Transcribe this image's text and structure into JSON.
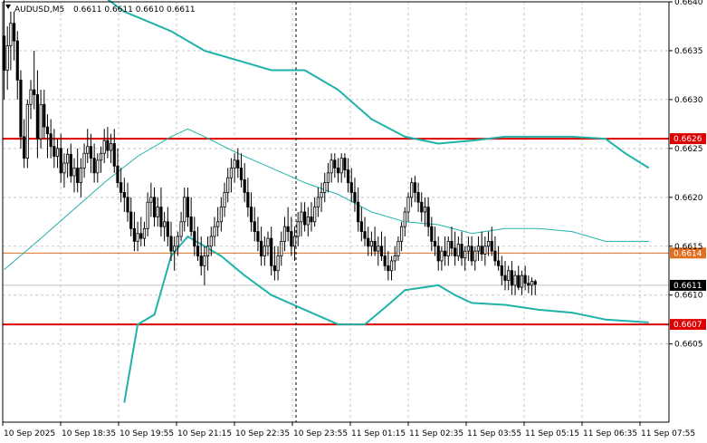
{
  "header": {
    "symbol_text": "AUDUSD,M5",
    "ohlc_text": "0.6611 0.6611 0.6610 0.6611"
  },
  "colors": {
    "bollinger": "#20b2aa",
    "sma": "#20b2aa",
    "level_major": "#dd0000",
    "level_minor": "#e07020",
    "price_line": "#c0c0c0",
    "candle": "#000000",
    "grid": "#c8c8c8"
  },
  "chart_data": {
    "type": "candlestick",
    "symbol": "AUDUSD",
    "timeframe": "M5",
    "ylim": [
      0.6597,
      0.664
    ],
    "y_ticks": [
      "0.6640",
      "0.6635",
      "0.6630",
      "0.6625",
      "0.6620",
      "0.6615",
      "0.6610",
      "0.6605"
    ],
    "x_ticks": [
      "10 Sep 2025",
      "10 Sep 18:35",
      "10 Sep 19:55",
      "10 Sep 21:15",
      "10 Sep 22:35",
      "10 Sep 23:55",
      "11 Sep 01:15",
      "11 Sep 02:35",
      "11 Sep 03:55",
      "11 Sep 05:15",
      "11 Sep 06:35",
      "11 Sep 07:55"
    ],
    "current_price": "0.6611",
    "levels": [
      {
        "value": 0.6626,
        "label": "0.6626",
        "kind": "major"
      },
      {
        "value": 0.66143,
        "label": "0.6614",
        "kind": "minor"
      },
      {
        "value": 0.6607,
        "label": "0.6607",
        "kind": "major"
      }
    ],
    "bollinger_upper": [
      [
        0,
        0.6641
      ],
      [
        28,
        0.6641
      ],
      [
        36,
        0.6639
      ],
      [
        50,
        0.6637
      ],
      [
        60,
        0.6635
      ],
      [
        70,
        0.6634
      ],
      [
        80,
        0.6633
      ],
      [
        90,
        0.6633
      ],
      [
        100,
        0.6631
      ],
      [
        110,
        0.6628
      ],
      [
        120,
        0.66262
      ],
      [
        130,
        0.66255
      ],
      [
        140,
        0.66258
      ],
      [
        150,
        0.66262
      ],
      [
        160,
        0.66262
      ],
      [
        170,
        0.66262
      ],
      [
        180,
        0.6626
      ],
      [
        186,
        0.66245
      ],
      [
        193,
        0.6623
      ]
    ],
    "bollinger_middle": [
      [
        0,
        0.66126
      ],
      [
        10,
        0.66155
      ],
      [
        20,
        0.66185
      ],
      [
        30,
        0.66215
      ],
      [
        40,
        0.66242
      ],
      [
        50,
        0.66262
      ],
      [
        55,
        0.6627
      ],
      [
        60,
        0.66262
      ],
      [
        70,
        0.66245
      ],
      [
        80,
        0.6623
      ],
      [
        90,
        0.66215
      ],
      [
        100,
        0.66203
      ],
      [
        110,
        0.66185
      ],
      [
        120,
        0.66175
      ],
      [
        130,
        0.66172
      ],
      [
        140,
        0.66163
      ],
      [
        150,
        0.66168
      ],
      [
        160,
        0.66168
      ],
      [
        170,
        0.66165
      ],
      [
        180,
        0.66155
      ],
      [
        193,
        0.66155
      ]
    ],
    "bollinger_lower": [
      [
        36,
        0.6599
      ],
      [
        40,
        0.6607
      ],
      [
        45,
        0.6608
      ],
      [
        50,
        0.6614
      ],
      [
        55,
        0.6616
      ],
      [
        65,
        0.6614
      ],
      [
        72,
        0.6612
      ],
      [
        80,
        0.661
      ],
      [
        90,
        0.66085
      ],
      [
        100,
        0.6607
      ],
      [
        108,
        0.6607
      ],
      [
        115,
        0.6609
      ],
      [
        120,
        0.66105
      ],
      [
        130,
        0.6611
      ],
      [
        135,
        0.661
      ],
      [
        140,
        0.66092
      ],
      [
        150,
        0.6609
      ],
      [
        160,
        0.66085
      ],
      [
        170,
        0.66082
      ],
      [
        180,
        0.66075
      ],
      [
        193,
        0.66072
      ]
    ],
    "candles": [
      [
        0.66365,
        0.6641,
        0.663,
        0.6633
      ],
      [
        0.6633,
        0.66375,
        0.6631,
        0.66355
      ],
      [
        0.66355,
        0.6639,
        0.6633,
        0.66378
      ],
      [
        0.66378,
        0.6639,
        0.6634,
        0.6636
      ],
      [
        0.6636,
        0.6637,
        0.663,
        0.6632
      ],
      [
        0.6632,
        0.6633,
        0.6625,
        0.66262
      ],
      [
        0.66262,
        0.6628,
        0.6623,
        0.6624
      ],
      [
        0.6624,
        0.663,
        0.6623,
        0.66295
      ],
      [
        0.66295,
        0.6632,
        0.6628,
        0.6631
      ],
      [
        0.6631,
        0.6635,
        0.6629,
        0.66305
      ],
      [
        0.66305,
        0.6633,
        0.6624,
        0.6626
      ],
      [
        0.6626,
        0.6631,
        0.6625,
        0.66295
      ],
      [
        0.66295,
        0.6631,
        0.6626,
        0.66272
      ],
      [
        0.66272,
        0.66285,
        0.6624,
        0.66265
      ],
      [
        0.66265,
        0.6628,
        0.6624,
        0.66252
      ],
      [
        0.66252,
        0.6627,
        0.6623,
        0.66242
      ],
      [
        0.66242,
        0.6626,
        0.6623,
        0.6625
      ],
      [
        0.6625,
        0.66265,
        0.66215,
        0.66225
      ],
      [
        0.66225,
        0.66245,
        0.6621,
        0.66235
      ],
      [
        0.66235,
        0.6625,
        0.6622,
        0.66244
      ],
      [
        0.66244,
        0.66255,
        0.66215,
        0.66222
      ],
      [
        0.66222,
        0.6624,
        0.66205,
        0.6623
      ],
      [
        0.6623,
        0.6625,
        0.66205,
        0.66215
      ],
      [
        0.66215,
        0.6624,
        0.662,
        0.6623
      ],
      [
        0.6623,
        0.66255,
        0.6622,
        0.66245
      ],
      [
        0.66245,
        0.6627,
        0.66235,
        0.66252
      ],
      [
        0.66252,
        0.66265,
        0.66225,
        0.6624
      ],
      [
        0.6624,
        0.66255,
        0.66215,
        0.66225
      ],
      [
        0.66225,
        0.66245,
        0.66215,
        0.66238
      ],
      [
        0.66238,
        0.66252,
        0.66225,
        0.66245
      ],
      [
        0.66245,
        0.6627,
        0.66235,
        0.66258
      ],
      [
        0.66258,
        0.66272,
        0.6624,
        0.66248
      ],
      [
        0.66248,
        0.66265,
        0.66235,
        0.66255
      ],
      [
        0.66255,
        0.6627,
        0.66225,
        0.66232
      ],
      [
        0.66232,
        0.6625,
        0.6621,
        0.66215
      ],
      [
        0.66215,
        0.6623,
        0.66195,
        0.66205
      ],
      [
        0.66205,
        0.6622,
        0.66185,
        0.662
      ],
      [
        0.662,
        0.66215,
        0.66175,
        0.66185
      ],
      [
        0.66185,
        0.662,
        0.6616,
        0.66168
      ],
      [
        0.66168,
        0.66185,
        0.66145,
        0.66155
      ],
      [
        0.66155,
        0.66175,
        0.66145,
        0.66163
      ],
      [
        0.66163,
        0.6618,
        0.6615,
        0.66158
      ],
      [
        0.66158,
        0.66175,
        0.6615,
        0.66168
      ],
      [
        0.66168,
        0.66205,
        0.6616,
        0.66195
      ],
      [
        0.66195,
        0.66215,
        0.6618,
        0.662
      ],
      [
        0.662,
        0.6621,
        0.6617,
        0.6618
      ],
      [
        0.6618,
        0.662,
        0.6617,
        0.6619
      ],
      [
        0.6619,
        0.6621,
        0.6616,
        0.6617
      ],
      [
        0.6617,
        0.66185,
        0.66155,
        0.66175
      ],
      [
        0.66175,
        0.6619,
        0.6615,
        0.6616
      ],
      [
        0.6616,
        0.66175,
        0.66135,
        0.66145
      ],
      [
        0.66145,
        0.6616,
        0.66125,
        0.6615
      ],
      [
        0.6615,
        0.66165,
        0.6614,
        0.6616
      ],
      [
        0.6616,
        0.66185,
        0.66155,
        0.66175
      ],
      [
        0.66175,
        0.6621,
        0.66165,
        0.662
      ],
      [
        0.662,
        0.6621,
        0.6617,
        0.6618
      ],
      [
        0.6618,
        0.662,
        0.6616,
        0.66165
      ],
      [
        0.66165,
        0.6618,
        0.6614,
        0.6615
      ],
      [
        0.6615,
        0.6617,
        0.66135,
        0.6614
      ],
      [
        0.6614,
        0.6616,
        0.6612,
        0.6613
      ],
      [
        0.6613,
        0.6615,
        0.6611,
        0.6614
      ],
      [
        0.6614,
        0.6616,
        0.66125,
        0.6615
      ],
      [
        0.6615,
        0.6617,
        0.6614,
        0.6616
      ],
      [
        0.6616,
        0.6618,
        0.6615,
        0.6617
      ],
      [
        0.6617,
        0.6619,
        0.6616,
        0.66175
      ],
      [
        0.66175,
        0.662,
        0.66165,
        0.6619
      ],
      [
        0.6619,
        0.66215,
        0.6618,
        0.66205
      ],
      [
        0.66205,
        0.6623,
        0.66195,
        0.6622
      ],
      [
        0.6622,
        0.6624,
        0.66205,
        0.6623
      ],
      [
        0.6623,
        0.66245,
        0.66215,
        0.66238
      ],
      [
        0.66238,
        0.6625,
        0.6622,
        0.6623
      ],
      [
        0.6623,
        0.66245,
        0.6621,
        0.66218
      ],
      [
        0.66218,
        0.66235,
        0.66195,
        0.66205
      ],
      [
        0.66205,
        0.6622,
        0.6618,
        0.6619
      ],
      [
        0.6619,
        0.66205,
        0.66165,
        0.66175
      ],
      [
        0.66175,
        0.6619,
        0.66155,
        0.66165
      ],
      [
        0.66165,
        0.6618,
        0.66145,
        0.66155
      ],
      [
        0.66155,
        0.6617,
        0.6613,
        0.6614
      ],
      [
        0.6614,
        0.6616,
        0.6613,
        0.6615
      ],
      [
        0.6615,
        0.66165,
        0.6614,
        0.66158
      ],
      [
        0.66158,
        0.6617,
        0.6612,
        0.6613
      ],
      [
        0.6613,
        0.6615,
        0.66115,
        0.66125
      ],
      [
        0.66125,
        0.6615,
        0.66115,
        0.6614
      ],
      [
        0.6614,
        0.66165,
        0.6613,
        0.66155
      ],
      [
        0.66155,
        0.6618,
        0.66145,
        0.6617
      ],
      [
        0.6617,
        0.6619,
        0.66155,
        0.66165
      ],
      [
        0.66165,
        0.6618,
        0.6614,
        0.6615
      ],
      [
        0.6615,
        0.6617,
        0.66135,
        0.6616
      ],
      [
        0.6616,
        0.66185,
        0.6615,
        0.66175
      ],
      [
        0.66175,
        0.66195,
        0.6616,
        0.66185
      ],
      [
        0.66185,
        0.66195,
        0.66165,
        0.66172
      ],
      [
        0.66172,
        0.6619,
        0.6616,
        0.6618
      ],
      [
        0.6618,
        0.66195,
        0.66165,
        0.66175
      ],
      [
        0.66175,
        0.662,
        0.6617,
        0.6619
      ],
      [
        0.6619,
        0.6621,
        0.6618,
        0.662
      ],
      [
        0.662,
        0.66215,
        0.66185,
        0.66205
      ],
      [
        0.66205,
        0.66225,
        0.66195,
        0.66215
      ],
      [
        0.66215,
        0.66235,
        0.66205,
        0.66225
      ],
      [
        0.66225,
        0.66245,
        0.66215,
        0.66238
      ],
      [
        0.66238,
        0.66245,
        0.6622,
        0.6623
      ],
      [
        0.6623,
        0.6624,
        0.66215,
        0.66225
      ],
      [
        0.66225,
        0.66245,
        0.66215,
        0.6624
      ],
      [
        0.6624,
        0.66245,
        0.6622,
        0.66228
      ],
      [
        0.66228,
        0.6624,
        0.66205,
        0.66215
      ],
      [
        0.66215,
        0.6623,
        0.66195,
        0.66205
      ],
      [
        0.66205,
        0.6622,
        0.66185,
        0.66195
      ],
      [
        0.66195,
        0.6621,
        0.66165,
        0.66175
      ],
      [
        0.66175,
        0.6619,
        0.66155,
        0.66165
      ],
      [
        0.66165,
        0.6618,
        0.6615,
        0.66158
      ],
      [
        0.66158,
        0.6617,
        0.6614,
        0.6615
      ],
      [
        0.6615,
        0.66165,
        0.6614,
        0.66155
      ],
      [
        0.66155,
        0.6617,
        0.6614,
        0.66145
      ],
      [
        0.66145,
        0.6616,
        0.6613,
        0.6615
      ],
      [
        0.6615,
        0.66165,
        0.66135,
        0.6614
      ],
      [
        0.6614,
        0.6616,
        0.66125,
        0.6613
      ],
      [
        0.6613,
        0.66145,
        0.66115,
        0.66125
      ],
      [
        0.66125,
        0.6614,
        0.66115,
        0.66135
      ],
      [
        0.66135,
        0.6615,
        0.66125,
        0.6614
      ],
      [
        0.6614,
        0.6616,
        0.66135,
        0.66155
      ],
      [
        0.66155,
        0.66175,
        0.66145,
        0.6617
      ],
      [
        0.6617,
        0.6619,
        0.6616,
        0.66185
      ],
      [
        0.66185,
        0.66205,
        0.66175,
        0.662
      ],
      [
        0.662,
        0.6622,
        0.6619,
        0.66215
      ],
      [
        0.66215,
        0.66222,
        0.66195,
        0.66205
      ],
      [
        0.66205,
        0.66215,
        0.66185,
        0.66195
      ],
      [
        0.66195,
        0.66205,
        0.66175,
        0.66185
      ],
      [
        0.66185,
        0.662,
        0.6617,
        0.6619
      ],
      [
        0.6619,
        0.662,
        0.6616,
        0.6617
      ],
      [
        0.6617,
        0.6618,
        0.66145,
        0.66155
      ],
      [
        0.66155,
        0.6617,
        0.6614,
        0.6615
      ],
      [
        0.6615,
        0.6616,
        0.66125,
        0.66135
      ],
      [
        0.66135,
        0.6615,
        0.66125,
        0.66145
      ],
      [
        0.66145,
        0.6616,
        0.6613,
        0.6614
      ],
      [
        0.6614,
        0.6616,
        0.6613,
        0.66155
      ],
      [
        0.66155,
        0.6617,
        0.6614,
        0.66148
      ],
      [
        0.66148,
        0.66165,
        0.6613,
        0.6614
      ],
      [
        0.6614,
        0.6616,
        0.66135,
        0.66152
      ],
      [
        0.66152,
        0.66165,
        0.6613,
        0.66138
      ],
      [
        0.66138,
        0.6615,
        0.66125,
        0.66145
      ],
      [
        0.66145,
        0.6616,
        0.66135,
        0.6615
      ],
      [
        0.6615,
        0.6616,
        0.6613,
        0.66135
      ],
      [
        0.66135,
        0.6615,
        0.66125,
        0.66145
      ],
      [
        0.66145,
        0.6616,
        0.66135,
        0.6615
      ],
      [
        0.6615,
        0.66165,
        0.66135,
        0.66142
      ],
      [
        0.66142,
        0.6616,
        0.6613,
        0.6615
      ],
      [
        0.6615,
        0.66165,
        0.6614,
        0.66155
      ],
      [
        0.66155,
        0.6617,
        0.6614,
        0.66145
      ],
      [
        0.66145,
        0.6616,
        0.6613,
        0.66135
      ],
      [
        0.66135,
        0.6615,
        0.66125,
        0.6613
      ],
      [
        0.6613,
        0.6614,
        0.6611,
        0.6612
      ],
      [
        0.6612,
        0.66135,
        0.66105,
        0.66115
      ],
      [
        0.66115,
        0.6613,
        0.66105,
        0.66125
      ],
      [
        0.66125,
        0.66135,
        0.661,
        0.6611
      ],
      [
        0.6611,
        0.66125,
        0.661,
        0.6612
      ],
      [
        0.6612,
        0.6613,
        0.66105,
        0.66108
      ],
      [
        0.66108,
        0.66125,
        0.661,
        0.6612
      ],
      [
        0.6612,
        0.6613,
        0.66105,
        0.66112
      ],
      [
        0.66112,
        0.6612,
        0.66102,
        0.6611
      ],
      [
        0.6611,
        0.66118,
        0.661,
        0.66114
      ],
      [
        0.66114,
        0.66116,
        0.661,
        0.66111
      ]
    ]
  }
}
